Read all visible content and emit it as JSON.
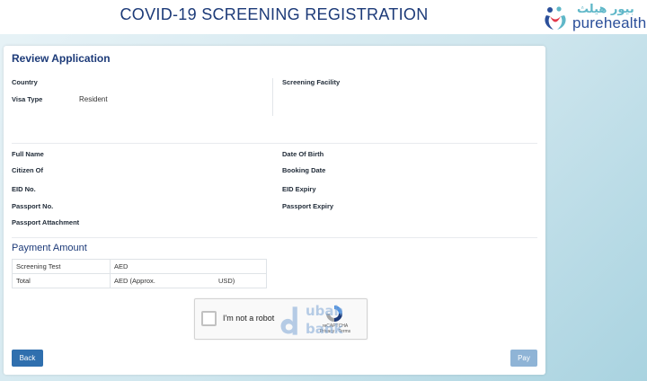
{
  "header": {
    "title": "COVID-19 SCREENING REGISTRATION",
    "logo_arabic": "بيور هيلث",
    "logo_text": "purehealth"
  },
  "review": {
    "title": "Review Application",
    "country_label": "Country",
    "visa_type_label": "Visa Type",
    "visa_type_value": "Resident",
    "screening_facility_label": "Screening Facility"
  },
  "personal": {
    "full_name_label": "Full Name",
    "citizen_of_label": "Citizen Of",
    "eid_no_label": "EID No.",
    "passport_no_label": "Passport No.",
    "passport_attachment_label": "Passport Attachment",
    "date_of_birth_label": "Date Of Birth",
    "booking_date_label": "Booking Date",
    "eid_expiry_label": "EID Expiry",
    "passport_expiry_label": "Passport Expiry"
  },
  "payment": {
    "title": "Payment Amount",
    "rows": [
      {
        "label": "Screening Test",
        "value": "AED",
        "extra": ""
      },
      {
        "label": "Total",
        "value": "AED (Approx.",
        "extra": "USD)"
      }
    ]
  },
  "captcha": {
    "label": "I'm not a robot",
    "brand_line1": "reCAPTCHA",
    "brand_line2": "Privacy - Terms"
  },
  "watermark": {
    "line1": "ubah",
    "line2": "bank"
  },
  "actions": {
    "back_label": "Back",
    "pay_label": "Pay"
  },
  "colors": {
    "brand_blue": "#1c3a78",
    "button_blue": "#2f6fae",
    "button_disabled": "#8fb4d6",
    "accent_teal": "#5fb7c8"
  }
}
